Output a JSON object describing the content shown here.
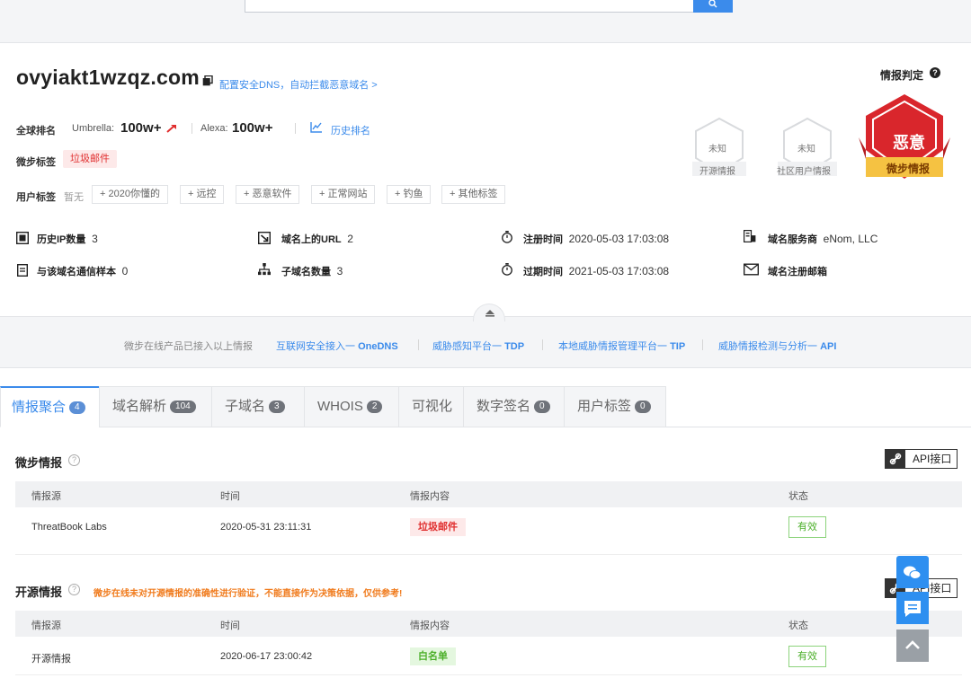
{
  "search": {
    "button_icon": "search-icon"
  },
  "header": {
    "domain": "ovyiakt1wzqz.com",
    "dns_link": "配置安全DNS，自动拦截恶意域名 >",
    "rank_label": "全球排名",
    "umbrella_label": "Umbrella:",
    "umbrella_value": "100w+",
    "alexa_label": "Alexa:",
    "alexa_value": "100w+",
    "history_rank": "历史排名",
    "tag_label": "微步标签",
    "tag_value": "垃圾邮件",
    "user_tag_label": "用户标签",
    "user_tag_none": "暂无",
    "user_tags": [
      "+ 2020你懂的",
      "+ 远控",
      "+ 恶意软件",
      "+ 正常网站",
      "+ 钓鱼",
      "+ 其他标签"
    ]
  },
  "stats": {
    "history_ip_label": "历史IP数量",
    "history_ip_value": "3",
    "url_label": "域名上的URL",
    "url_value": "2",
    "reg_time_label": "注册时间",
    "reg_time_value": "2020-05-03 17:03:08",
    "registrar_label": "域名服务商",
    "registrar_value": "eNom, LLC",
    "sample_label": "与该域名通信样本",
    "sample_value": "0",
    "subdomain_label": "子域名数量",
    "subdomain_value": "3",
    "exp_time_label": "过期时间",
    "exp_time_value": "2021-05-03 17:03:08",
    "reg_email_label": "域名注册邮箱"
  },
  "verdict": {
    "title": "情报判定",
    "open_source_status": "未知",
    "open_source_label": "开源情报",
    "community_status": "未知",
    "community_label": "社区用户情报",
    "main_status": "恶意",
    "main_label": "微步情报",
    "colors": {
      "malicious": "#d9262c",
      "banner": "#f5c242"
    }
  },
  "promo": {
    "intro": "微步在线产品已接入以上情报",
    "links": [
      {
        "prefix": "互联网安全接入一 ",
        "name": "OneDNS"
      },
      {
        "prefix": "威胁感知平台一 ",
        "name": "TDP"
      },
      {
        "prefix": "本地威胁情报管理平台一 ",
        "name": "TIP"
      },
      {
        "prefix": "威胁情报检测与分析一 ",
        "name": "API"
      }
    ]
  },
  "tabs": [
    {
      "label": "情报聚合",
      "count": "4"
    },
    {
      "label": "域名解析",
      "count": "104"
    },
    {
      "label": "子域名",
      "count": "3"
    },
    {
      "label": "WHOIS",
      "count": "2"
    },
    {
      "label": "可视化",
      "count": ""
    },
    {
      "label": "数字签名",
      "count": "0"
    },
    {
      "label": "用户标签",
      "count": "0"
    }
  ],
  "threatbook": {
    "title": "微步情报",
    "api_label": "API接口",
    "headers": [
      "情报源",
      "时间",
      "情报内容",
      "状态"
    ],
    "rows": [
      {
        "source": "ThreatBook Labs",
        "time": "2020-05-31 23:11:31",
        "content": "垃圾邮件",
        "status": "有效"
      }
    ]
  },
  "opensource": {
    "title": "开源情报",
    "warning": "微步在线未对开源情报的准确性进行验证，不能直接作为决策依据，仅供参考!",
    "api_label": "API接口",
    "headers": [
      "情报源",
      "时间",
      "情报内容",
      "状态"
    ],
    "rows": [
      {
        "source": "开源情报",
        "time": "2020-06-17 23:00:42",
        "content": "白名单",
        "status": "有效"
      }
    ]
  },
  "floating": [
    "wechat-icon",
    "chat-icon",
    "back-to-top-icon"
  ]
}
